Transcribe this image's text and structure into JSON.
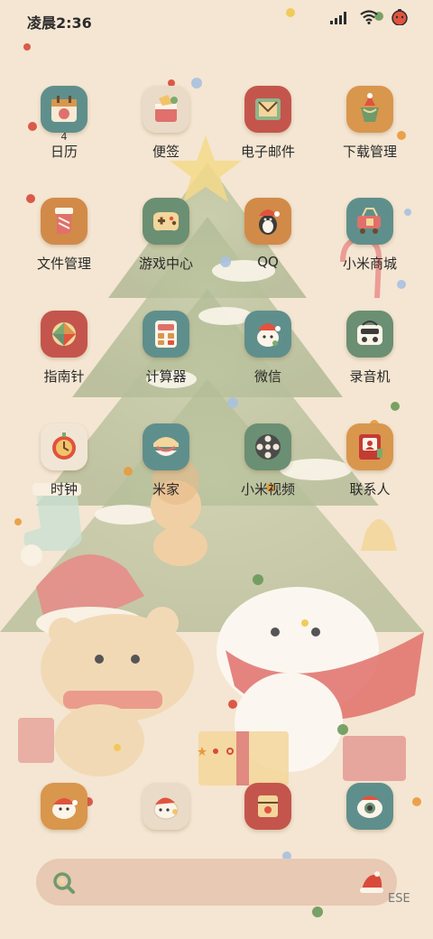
{
  "status_bar": {
    "time": "凌晨2:36"
  },
  "apps": [
    {
      "label": "日历",
      "badge": "4",
      "tile_color": "#5f8f8c",
      "icon": "calendar-icon"
    },
    {
      "label": "便签",
      "tile_color": "#eadbc8",
      "icon": "notes-icon"
    },
    {
      "label": "电子邮件",
      "tile_color": "#c4554c",
      "icon": "email-icon"
    },
    {
      "label": "下载管理",
      "tile_color": "#d9964d",
      "icon": "download-icon"
    },
    {
      "label": "文件管理",
      "tile_color": "#d28a48",
      "icon": "folder-icon"
    },
    {
      "label": "游戏中心",
      "tile_color": "#6b8f73",
      "icon": "gamepad-icon"
    },
    {
      "label": "QQ",
      "tile_color": "#d28a48",
      "icon": "penguin-icon"
    },
    {
      "label": "小米商城",
      "tile_color": "#5f8f8c",
      "icon": "shopping-icon"
    },
    {
      "label": "指南针",
      "tile_color": "#c4554c",
      "icon": "compass-icon"
    },
    {
      "label": "计算器",
      "tile_color": "#5f8f8c",
      "icon": "calculator-icon"
    },
    {
      "label": "微信",
      "tile_color": "#5f8f8c",
      "icon": "chat-icon"
    },
    {
      "label": "录音机",
      "tile_color": "#6b8f73",
      "icon": "recorder-icon"
    },
    {
      "label": "时钟",
      "tile_color": "#f1e6d6",
      "icon": "clock-icon"
    },
    {
      "label": "米家",
      "tile_color": "#5f8f8c",
      "icon": "home-device-icon"
    },
    {
      "label": "小米视频",
      "tile_color": "#6b8f73",
      "icon": "film-reel-icon"
    },
    {
      "label": "联系人",
      "tile_color": "#d9964d",
      "icon": "contacts-icon"
    }
  ],
  "dock": [
    {
      "tile_color": "#d9964d",
      "icon": "phone-icon"
    },
    {
      "tile_color": "#eadbc8",
      "icon": "messages-icon"
    },
    {
      "tile_color": "#c4554c",
      "icon": "browser-icon"
    },
    {
      "tile_color": "#5f8f8c",
      "icon": "camera-icon"
    }
  ],
  "search_bar": {
    "corner_text": "ESE"
  },
  "colors": {
    "wallpaper_base": "#f4e6d2",
    "search_bar": "#e8c9b3"
  }
}
